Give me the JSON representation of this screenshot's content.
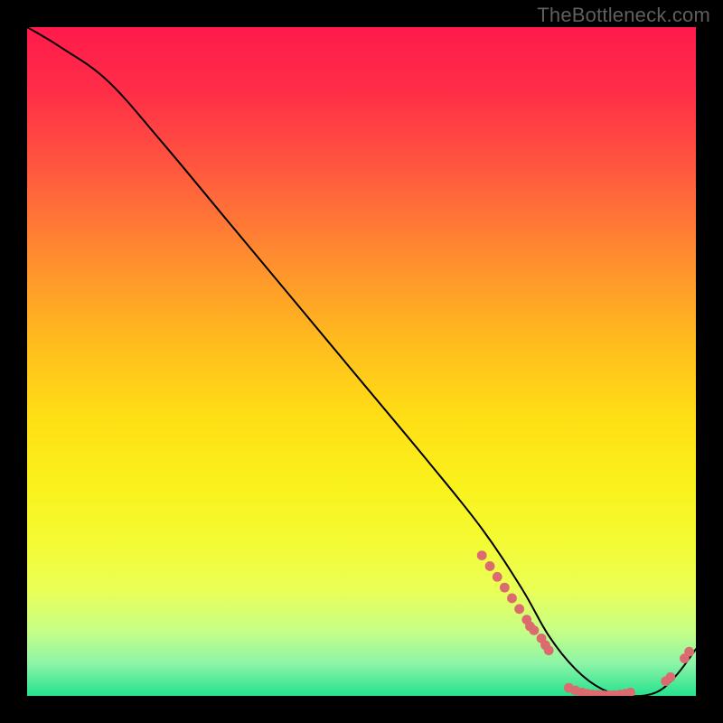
{
  "watermark": "TheBottleneck.com",
  "chart_data": {
    "type": "line",
    "title": "",
    "xlabel": "",
    "ylabel": "",
    "xlim": [
      0,
      100
    ],
    "ylim": [
      0,
      100
    ],
    "grid": false,
    "legend": false,
    "series": [
      {
        "name": "curve",
        "color": "#000000",
        "style": "line",
        "smooth": true,
        "x": [
          0,
          5,
          12,
          20,
          30,
          40,
          50,
          60,
          68,
          74,
          78,
          82,
          86,
          90,
          94,
          97,
          100
        ],
        "y": [
          100,
          97,
          92,
          83,
          71,
          59,
          47,
          35,
          25,
          16,
          9,
          4,
          1,
          0,
          0.5,
          3,
          7
        ]
      },
      {
        "name": "points-descent",
        "color": "#db6b6e",
        "style": "scatter",
        "x": [
          68.0,
          69.2,
          70.3,
          71.4,
          72.5,
          73.6,
          74.7,
          75.2,
          75.8,
          76.9
        ],
        "y": [
          21.0,
          19.4,
          17.8,
          16.2,
          14.6,
          13.0,
          11.4,
          10.4,
          9.8,
          8.6
        ]
      },
      {
        "name": "points-descent-pair",
        "color": "#db6b6e",
        "style": "scatter",
        "x": [
          77.5,
          78.0
        ],
        "y": [
          7.6,
          6.8
        ]
      },
      {
        "name": "points-floor",
        "color": "#db6b6e",
        "style": "scatter",
        "x": [
          81.0,
          82.0,
          83.0,
          83.8,
          84.6,
          85.4,
          86.2,
          87.0,
          87.8,
          88.6,
          89.4,
          90.2
        ],
        "y": [
          1.2,
          0.8,
          0.5,
          0.3,
          0.2,
          0.15,
          0.1,
          0.1,
          0.12,
          0.18,
          0.3,
          0.5
        ]
      },
      {
        "name": "points-rise",
        "color": "#db6b6e",
        "style": "scatter",
        "x": [
          95.5,
          96.2,
          98.3,
          99.0
        ],
        "y": [
          2.2,
          2.8,
          5.6,
          6.6
        ]
      }
    ],
    "gradient_stops": [
      {
        "pos": 0,
        "color": "#ff1a4c"
      },
      {
        "pos": 10,
        "color": "#ff2f47"
      },
      {
        "pos": 22,
        "color": "#ff5b3e"
      },
      {
        "pos": 34,
        "color": "#ff8b30"
      },
      {
        "pos": 46,
        "color": "#ffb81f"
      },
      {
        "pos": 58,
        "color": "#ffde15"
      },
      {
        "pos": 68,
        "color": "#faf11c"
      },
      {
        "pos": 76,
        "color": "#f5fa30"
      },
      {
        "pos": 84,
        "color": "#eaff55"
      },
      {
        "pos": 90,
        "color": "#c9ff84"
      },
      {
        "pos": 95,
        "color": "#8ff5a7"
      },
      {
        "pos": 100,
        "color": "#25e28f"
      }
    ]
  }
}
